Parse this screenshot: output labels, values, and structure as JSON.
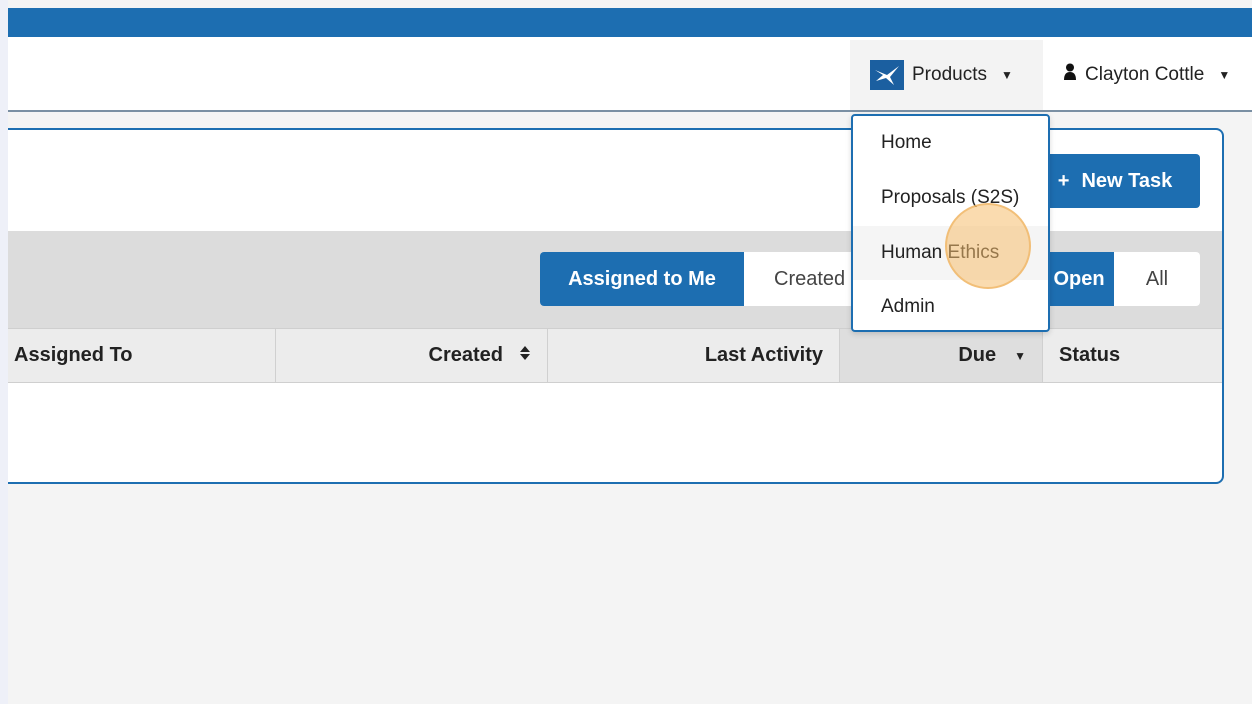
{
  "navbar": {
    "products_label": "Products",
    "user_name": "Clayton Cottle"
  },
  "products_menu": {
    "items": [
      {
        "label": "Home"
      },
      {
        "label": "Proposals (S2S)"
      },
      {
        "label": "Human Ethics"
      },
      {
        "label": "Admin"
      }
    ]
  },
  "tasks": {
    "new_task_label": "New Task",
    "filters": [
      {
        "label": "Assigned to Me",
        "active": true
      },
      {
        "label": "Created",
        "active": false
      },
      {
        "label": "Open",
        "active": true
      },
      {
        "label": "All",
        "active": false
      }
    ],
    "columns": [
      {
        "label": "Assigned To"
      },
      {
        "label": "Created"
      },
      {
        "label": "Last Activity"
      },
      {
        "label": "Due"
      },
      {
        "label": "Status"
      }
    ]
  },
  "colors": {
    "primary": "#1d6eb1",
    "topbar": "#1d6eb1",
    "background": "#f4f4f4"
  }
}
